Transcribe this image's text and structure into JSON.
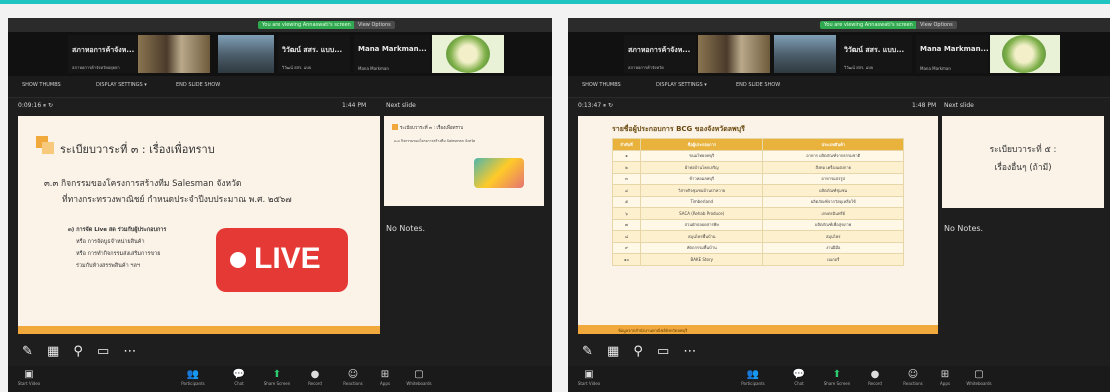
{
  "left_window": {
    "meeting_pill": "You are viewing Annaswati's screen",
    "options_pill": "View Options",
    "participants": [
      {
        "name": "สภาหอการค้าจังห...",
        "sub": "สภาหอการค้าจังหวัดอยุธยา"
      },
      {
        "name": "วิวัฒน์ สสร. แบบ...",
        "sub": "วิวัฒน์ สสร. แบบ"
      },
      {
        "name": "Mana Markman...",
        "sub": "Mana Markman"
      }
    ],
    "sharebar": {
      "show_thumbs": "SHOW THUMBS",
      "display_settings": "DISPLAY SETTINGS ▾",
      "end": "END SLIDE SHOW"
    },
    "timer": "0:09:16  ⏸  ↻",
    "clock": "1:44 PM",
    "next_slide_label": "Next slide",
    "slide": {
      "title": "ระเบียบวาระที่ ๓ : เรื่องเพื่อทราบ",
      "item": "๓.๓ กิจกรรมของโครงการสร้างทีม Salesman จังหวัด",
      "item2": "ที่ทางกระทรวงพาณิชย์ กำหนดประจำปีงบประมาณ พ.ศ. ๒๕๖๗",
      "sub1": "๓) การจัด Live สด ร่วมกับผู้ประกอบการ",
      "sub2": "หรือ การจัดบูธจำหน่ายสินค้า",
      "sub3": "หรือ การทำกิจกรรมส่งเสริมการขาย",
      "sub4": "ร่วมกับห้างสรรพสินค้า ฯลฯ",
      "live": "LIVE"
    },
    "next": {
      "title": "ระเบียบวาระที่ ๓ : เรื่องเพื่อทราบ",
      "line": "๓.๓ กิจกรรมของโครงการสร้างทีม Salesman จังหวัด"
    },
    "notes": "No Notes."
  },
  "right_window": {
    "meeting_pill": "You are viewing Annaswati's screen",
    "options_pill": "View Options",
    "participants": [
      {
        "name": "สภาหอการค้าจังห...",
        "sub": "สภาหอการค้าจังหวัด"
      },
      {
        "name": "วิวัฒน์ สสร. แบบ...",
        "sub": "วิวัฒน์ สสร. แบบ"
      },
      {
        "name": "Mana Markman...",
        "sub": "Mana Markman"
      }
    ],
    "sharebar": {
      "show_thumbs": "SHOW THUMBS",
      "display_settings": "DISPLAY SETTINGS ▾",
      "end": "END SLIDE SHOW"
    },
    "timer": "0:13:47  ⏸  ↻",
    "clock": "1:48 PM",
    "next_slide_label": "Next slide",
    "slide": {
      "title": "รายชื่อผู้ประกอบการ BCG ของจังหวัดลพบุรี",
      "headers": [
        "ลำดับที่",
        "ชื่อผู้ประกอบการ",
        "ประเภทสินค้า"
      ],
      "rows": [
        [
          "๑",
          "ขนมไทยลพบุรี",
          "อาหาร ผลิตภัณฑ์จากธรรมชาติ"
        ],
        [
          "๒",
          "ผ้าทอบ้านโคกเจริญ",
          "สิ่งทอ เครื่องแต่งกาย"
        ],
        [
          "๓",
          "ข้าวหอมลพบุรี",
          "อาหารแปรรูป"
        ],
        [
          "๔",
          "วิสาหกิจชุมชนบ้านป่าหวาย",
          "ผลิตภัณฑ์ชุมชน"
        ],
        [
          "๕",
          "Timberland",
          "ผลิตภัณฑ์จากวัสดุเหลือใช้"
        ],
        [
          "๖",
          "SACA (Rehab Produce)",
          "เกษตรอินทรีย์"
        ],
        [
          "๗",
          "สวนผักปลอดสารพิษ",
          "ผลิตภัณฑ์เพื่อสุขภาพ"
        ],
        [
          "๘",
          "สมุนไพรพื้นบ้าน",
          "สมุนไพร"
        ],
        [
          "๙",
          "หัตถกรรมพื้นบ้าน",
          "งานฝีมือ"
        ],
        [
          "๑๐",
          "BAKE Story",
          "เบเกอรี่"
        ]
      ],
      "footer": "ข้อมูลจากสำนักงานพาณิชย์จังหวัดลพบุรี"
    },
    "next": {
      "title": "ระเบียบวาระที่ ๕ :",
      "line": "เรื่องอื่นๆ (ถ้ามี)"
    },
    "notes": "No Notes."
  },
  "dock": [
    "Start Video",
    "Participants",
    "Chat",
    "Share Screen",
    "Record",
    "Reactions",
    "Apps",
    "Whiteboards"
  ],
  "dock_count": "4"
}
